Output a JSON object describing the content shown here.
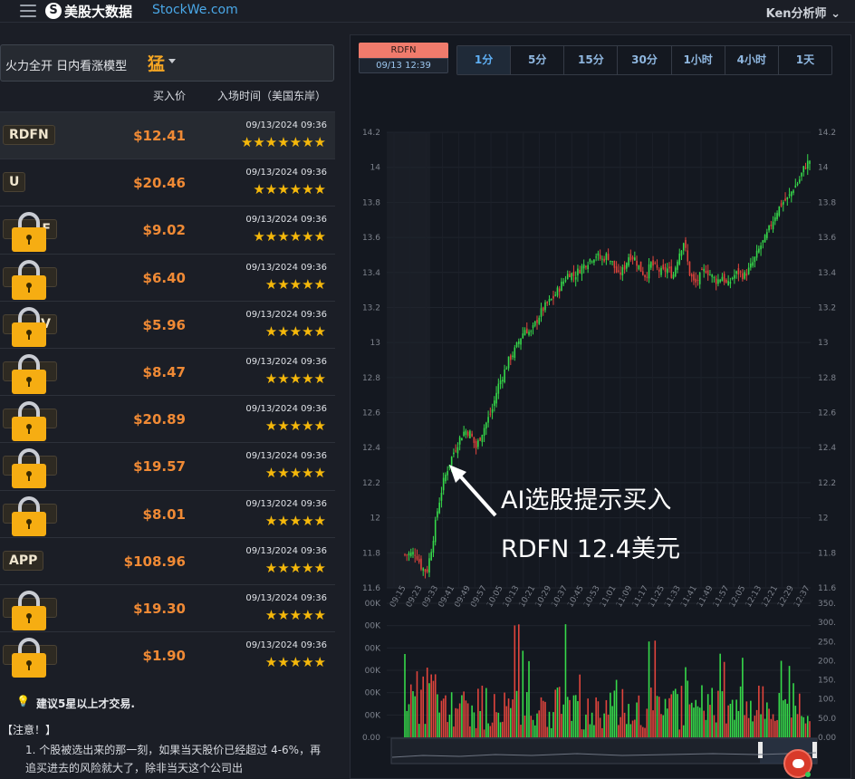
{
  "header": {
    "brand_cn": "美股大数据",
    "brand_en": "StockWe.com",
    "user": "Ken分析师"
  },
  "model": {
    "name": "火力全开 日内看涨模型",
    "level": "猛"
  },
  "table": {
    "headers": {
      "price": "买入价",
      "time": "入场时间（美国东岸）"
    },
    "rows": [
      {
        "ticker": "RDFN",
        "locked": false,
        "price": "$12.41",
        "time": "09/13/2024 09:36",
        "stars": 7
      },
      {
        "ticker": "U",
        "locked": false,
        "price": "$20.46",
        "time": "09/13/2024 09:36",
        "stars": 6
      },
      {
        "ticker": "F",
        "locked": true,
        "price": "$9.02",
        "time": "09/13/2024 09:36",
        "stars": 6
      },
      {
        "ticker": "",
        "locked": true,
        "price": "$6.40",
        "time": "09/13/2024 09:36",
        "stars": 5
      },
      {
        "ticker": "V",
        "locked": true,
        "price": "$5.96",
        "time": "09/13/2024 09:36",
        "stars": 5
      },
      {
        "ticker": "",
        "locked": true,
        "price": "$8.47",
        "time": "09/13/2024 09:36",
        "stars": 5
      },
      {
        "ticker": "",
        "locked": true,
        "price": "$20.89",
        "time": "09/13/2024 09:36",
        "stars": 5
      },
      {
        "ticker": "",
        "locked": true,
        "price": "$19.57",
        "time": "09/13/2024 09:36",
        "stars": 5
      },
      {
        "ticker": "",
        "locked": true,
        "price": "$8.01",
        "time": "09/13/2024 09:36",
        "stars": 5
      },
      {
        "ticker": "APP",
        "locked": false,
        "price": "$108.96",
        "time": "09/13/2024 09:36",
        "stars": 5
      },
      {
        "ticker": "",
        "locked": true,
        "price": "$19.30",
        "time": "09/13/2024 09:36",
        "stars": 5
      },
      {
        "ticker": "",
        "locked": true,
        "price": "$1.90",
        "time": "09/13/2024 09:36",
        "stars": 5
      }
    ]
  },
  "tip": "建议5星以上才交易.",
  "notice": {
    "title": "【注意！】",
    "text": "1. 个股被选出来的那一刻，如果当天股价已经超过 4-6%，再追买进去的风险就大了，除非当天这个公司出"
  },
  "chart_panel": {
    "symbol": "RDFN",
    "time": "09/13 12:39",
    "tabs": [
      "1分",
      "5分",
      "15分",
      "30分",
      "1小时",
      "4小时",
      "1天"
    ],
    "active_tab": 0,
    "annotation_line1": "AI选股提示买入",
    "annotation_line2": "RDFN 12.4美元"
  },
  "chart_data": {
    "type": "candlestick",
    "y_ticks": [
      "14.2",
      "14",
      "13.8",
      "13.6",
      "13.4",
      "13.2",
      "13",
      "12.8",
      "12.6",
      "12.4",
      "12.2",
      "12",
      "11.8",
      "11.6"
    ],
    "x_ticks": [
      "09:15",
      "09:23",
      "09:33",
      "09:41",
      "09:49",
      "09:57",
      "10:05",
      "10:13",
      "10:21",
      "10:29",
      "10:37",
      "10:45",
      "10:53",
      "11:01",
      "11:09",
      "11:17",
      "11:25",
      "11:33",
      "11:41",
      "11:49",
      "11:57",
      "12:05",
      "12:13",
      "12:21",
      "12:29",
      "12:37"
    ],
    "ylim": [
      11.6,
      14.2
    ],
    "close_path": [
      [
        0,
        11.79
      ],
      [
        2,
        11.8
      ],
      [
        3,
        11.72
      ],
      [
        4,
        11.69
      ],
      [
        5,
        11.85
      ],
      [
        6,
        12.05
      ],
      [
        7,
        12.2
      ],
      [
        8,
        12.3
      ],
      [
        9,
        12.38
      ],
      [
        10,
        12.45
      ],
      [
        11,
        12.5
      ],
      [
        12,
        12.48
      ],
      [
        13,
        12.4
      ],
      [
        14,
        12.48
      ],
      [
        15,
        12.55
      ],
      [
        16,
        12.62
      ],
      [
        17,
        12.75
      ],
      [
        18,
        12.82
      ],
      [
        19,
        12.9
      ],
      [
        20,
        12.95
      ],
      [
        21,
        13.02
      ],
      [
        22,
        13.08
      ],
      [
        23,
        13.05
      ],
      [
        24,
        13.12
      ],
      [
        25,
        13.18
      ],
      [
        26,
        13.22
      ],
      [
        27,
        13.25
      ],
      [
        28,
        13.3
      ],
      [
        29,
        13.35
      ],
      [
        30,
        13.4
      ],
      [
        31,
        13.38
      ],
      [
        32,
        13.42
      ],
      [
        33,
        13.45
      ],
      [
        34,
        13.48
      ],
      [
        35,
        13.5
      ],
      [
        36,
        13.47
      ],
      [
        37,
        13.5
      ],
      [
        38,
        13.45
      ],
      [
        39,
        13.38
      ],
      [
        40,
        13.42
      ],
      [
        41,
        13.5
      ],
      [
        42,
        13.48
      ],
      [
        43,
        13.42
      ],
      [
        44,
        13.38
      ],
      [
        45,
        13.45
      ],
      [
        46,
        13.42
      ],
      [
        47,
        13.4
      ],
      [
        48,
        13.42
      ],
      [
        49,
        13.38
      ],
      [
        50,
        13.5
      ],
      [
        51,
        13.58
      ],
      [
        52,
        13.4
      ],
      [
        53,
        13.33
      ],
      [
        54,
        13.38
      ],
      [
        55,
        13.42
      ],
      [
        56,
        13.38
      ],
      [
        57,
        13.35
      ],
      [
        58,
        13.38
      ],
      [
        59,
        13.32
      ],
      [
        60,
        13.38
      ],
      [
        61,
        13.4
      ],
      [
        62,
        13.38
      ],
      [
        63,
        13.42
      ],
      [
        64,
        13.48
      ],
      [
        65,
        13.55
      ],
      [
        66,
        13.6
      ],
      [
        67,
        13.68
      ],
      [
        68,
        13.75
      ],
      [
        69,
        13.8
      ],
      [
        70,
        13.82
      ],
      [
        71,
        13.88
      ],
      [
        72,
        13.92
      ],
      [
        73,
        14.0
      ],
      [
        74,
        14.04
      ]
    ],
    "volume_ticks_left": [
      "00K",
      "00K",
      "00K",
      "00K",
      "00K",
      "00K",
      "0.00"
    ],
    "volume_ticks_right": [
      "350.",
      "300.",
      "250.",
      "200.",
      "150.",
      "100.",
      "50.0",
      "0.00"
    ]
  }
}
